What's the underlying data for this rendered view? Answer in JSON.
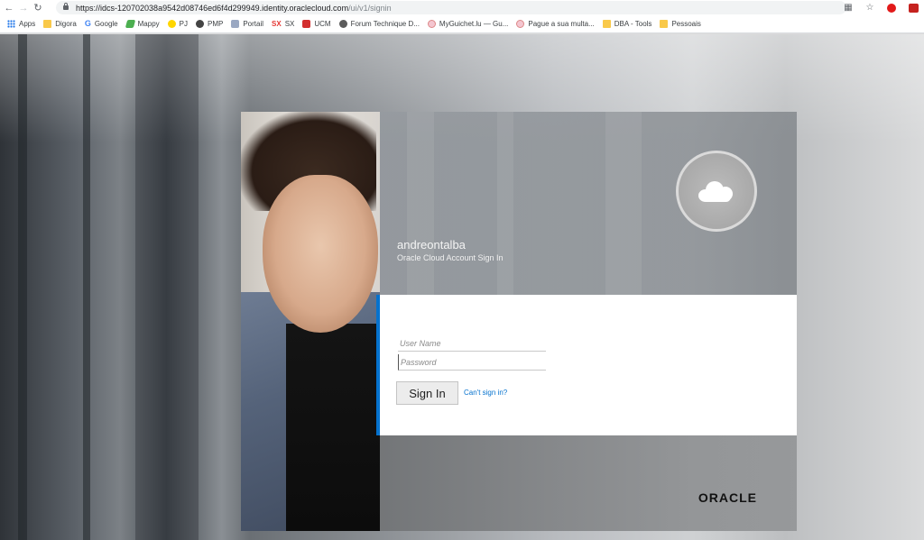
{
  "browser": {
    "url_main": "https://idcs-120702038a9542d08746ed6f4d299949.identity.oraclecloud.com",
    "url_path": "/ui/v1/signin",
    "bookmarks": [
      {
        "label": "Apps",
        "icon": "apps-grid-icon"
      },
      {
        "label": "Digora",
        "icon": "folder-icon"
      },
      {
        "label": "Google",
        "icon": "google-icon"
      },
      {
        "label": "Mappy",
        "icon": "mappy-icon"
      },
      {
        "label": "PJ",
        "icon": "pj-icon"
      },
      {
        "label": "PMP",
        "icon": "globe-icon"
      },
      {
        "label": "Portail",
        "icon": "document-icon"
      },
      {
        "label": "SX",
        "icon": "sx-icon"
      },
      {
        "label": "UCM",
        "icon": "ucm-icon"
      },
      {
        "label": "Forum Technique D...",
        "icon": "gear-icon"
      },
      {
        "label": "MyGuichet.lu — Gu...",
        "icon": "myguichet-icon"
      },
      {
        "label": "Pague a sua multa...",
        "icon": "multa-icon"
      },
      {
        "label": "DBA - Tools",
        "icon": "folder-icon"
      },
      {
        "label": "Pessoais",
        "icon": "folder-icon"
      }
    ]
  },
  "signin": {
    "account_name": "andreontalba",
    "account_subtitle": "Oracle Cloud Account Sign In",
    "username_placeholder": "User Name",
    "password_placeholder": "Password",
    "signin_label": "Sign In",
    "cant_signin_label": "Can't sign in?",
    "brand": "ORACLE",
    "accent_color": "#0572ce"
  }
}
